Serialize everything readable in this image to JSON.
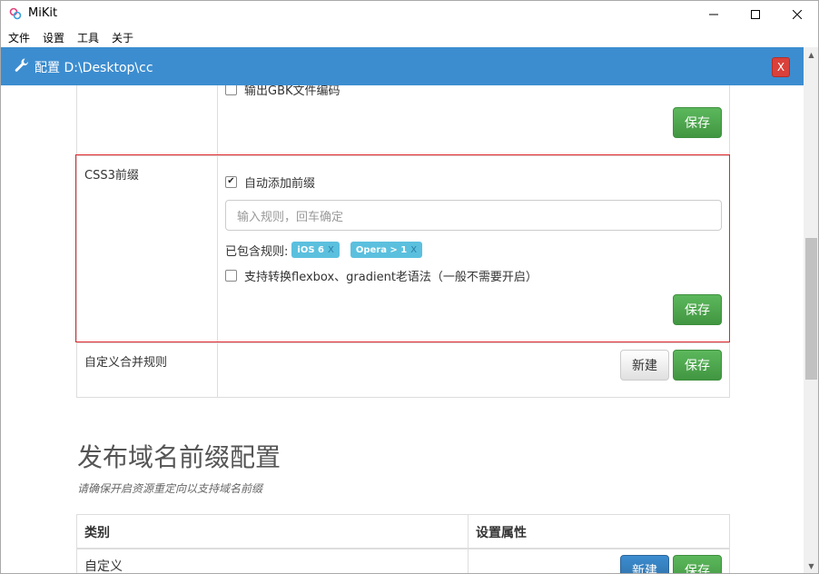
{
  "window": {
    "title": "MiKit",
    "controls": {
      "minimize": "—",
      "maximize": "☐",
      "close": "✕"
    }
  },
  "menu": {
    "items": [
      "文件",
      "设置",
      "工具",
      "关于"
    ]
  },
  "header": {
    "title": "配置 D:\\Desktop\\cc",
    "close_label": "X"
  },
  "gbk_section": {
    "checkbox_label": "输出GBK文件编码",
    "checked": false,
    "save_label": "保存"
  },
  "css3_section": {
    "label": "CSS3前缀",
    "autoprefix_label": "自动添加前缀",
    "autoprefix_checked": true,
    "rule_placeholder": "输入规则，回车确定",
    "included_rules_label": "已包含规则:",
    "tags": [
      {
        "text": "iOS 6",
        "remove": "X"
      },
      {
        "text": "Opera > 1",
        "remove": "X"
      }
    ],
    "legacy_label": "支持转换flexbox、gradient老语法（一般不需要开启）",
    "legacy_checked": false,
    "save_label": "保存"
  },
  "merge_section": {
    "label": "自定义合并规则",
    "new_label": "新建",
    "save_label": "保存"
  },
  "domain_section": {
    "title": "发布域名前缀配置",
    "subtitle": "请确保开启资源重定向以支持域名前缀",
    "columns": [
      "类别",
      "设置属性"
    ],
    "rows": [
      {
        "category": "自定义",
        "new_label": "新建",
        "save_label": "保存"
      }
    ]
  },
  "colors": {
    "header": "#3c8dd0",
    "success": "#5cb85c",
    "primary": "#337ab7",
    "danger": "#d9413a",
    "tag": "#5bc0de",
    "highlight": "#e0252b"
  }
}
